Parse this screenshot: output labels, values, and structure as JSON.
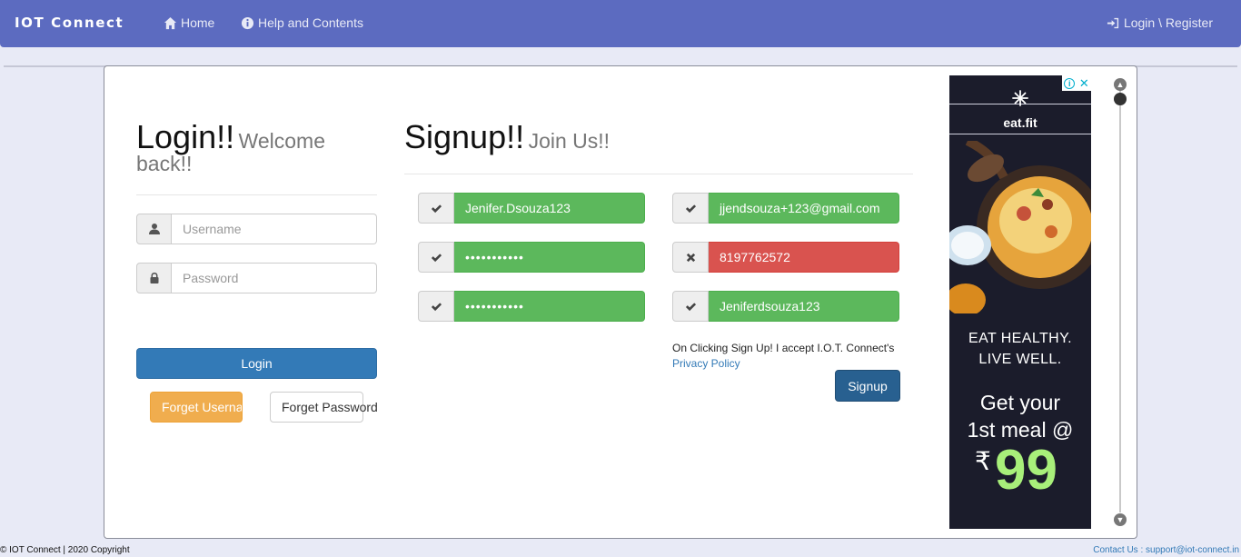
{
  "navbar": {
    "brand": "IOT Connect",
    "home": "Home",
    "help": "Help and Contents",
    "login_register": "Login \\ Register"
  },
  "login": {
    "title": "Login!!",
    "subtitle": "Welcome back!!",
    "username_placeholder": "Username",
    "password_placeholder": "Password",
    "login_button": "Login",
    "forget_username_button": "Forget Username",
    "forget_password_button": "Forget Password"
  },
  "signup": {
    "title": "Signup!!",
    "subtitle": "Join Us!!",
    "fields": [
      {
        "value": "Jenifer.Dsouza123",
        "status": "valid"
      },
      {
        "value": "jjendsouza+123@gmail.com",
        "status": "valid"
      },
      {
        "value": "•••••••••••",
        "status": "valid"
      },
      {
        "value": "8197762572",
        "status": "invalid"
      },
      {
        "value": "•••••••••••",
        "status": "valid"
      },
      {
        "value": "Jeniferdsouza123",
        "status": "valid"
      }
    ],
    "terms_text": "On Clicking Sign Up! I accept I.O.T. Connect's",
    "privacy_link": "Privacy Policy",
    "signup_button": "Signup"
  },
  "ad": {
    "brand": "eat.fit",
    "tagline": "EAT HEALTHY. LIVE WELL.",
    "offer_line1": "Get your",
    "offer_line2": "1st meal @",
    "price_symbol": "₹",
    "price": "99"
  },
  "footer": {
    "copyright": "© IOT Connect | 2020 Copyright",
    "contact": "Contact Us : support@iot-connect.in"
  },
  "colors": {
    "navbar": "#5c6bc0",
    "valid": "#5cb85c",
    "invalid": "#d9534f",
    "primary": "#337ab7",
    "warning": "#f0ad4e"
  }
}
